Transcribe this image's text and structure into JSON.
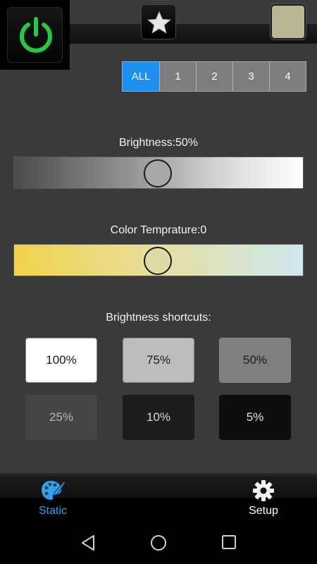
{
  "header": {
    "power_icon": "power-icon",
    "favorite_icon": "star-icon",
    "current_color": "#bab692"
  },
  "groups": {
    "items": [
      "ALL",
      "1",
      "2",
      "3",
      "4"
    ],
    "selected": "ALL",
    "accent": "#1b8ff2"
  },
  "brightness": {
    "label": "Brightness:50%",
    "value_percent": 50
  },
  "color_temperature": {
    "label": "Color Temprature:0",
    "value": 0,
    "position_fraction": 0.5
  },
  "shortcuts": {
    "title": "Brightness shortcuts:",
    "items": [
      "100%",
      "75%",
      "50%",
      "25%",
      "10%",
      "5%"
    ]
  },
  "tabs": {
    "static_label": "Static",
    "static_icon": "palette-icon",
    "setup_label": "Setup",
    "setup_icon": "gear-icon",
    "active": "Static",
    "active_color": "#2aa3f0"
  },
  "navbar": {
    "back_icon": "back-icon",
    "home_icon": "home-icon",
    "recents_icon": "recents-icon"
  }
}
